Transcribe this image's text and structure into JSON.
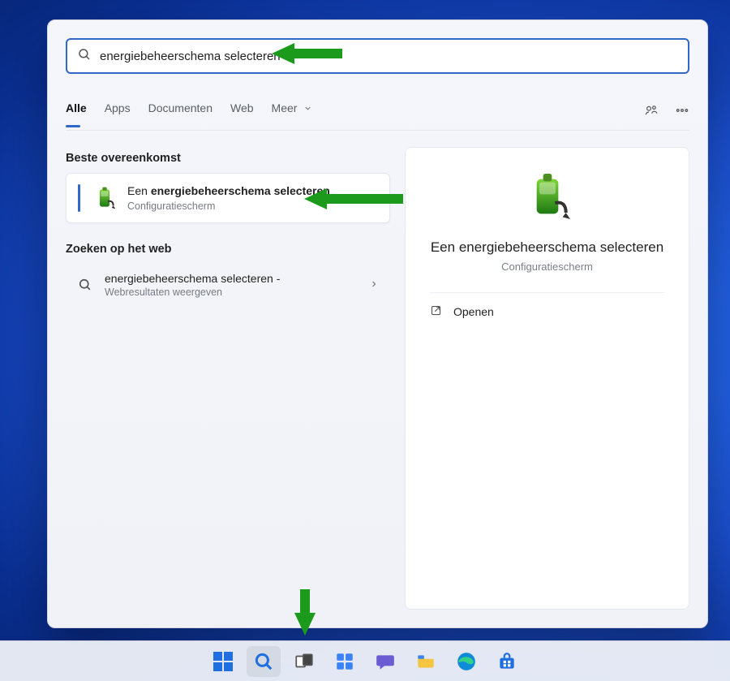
{
  "search": {
    "query": "energiebeheerschema selecteren"
  },
  "tabs": {
    "items": [
      "Alle",
      "Apps",
      "Documenten",
      "Web",
      "Meer"
    ],
    "active_index": 0
  },
  "sections": {
    "best_match_heading": "Beste overeenkomst",
    "web_heading": "Zoeken op het web"
  },
  "best_match": {
    "prefix": "Een ",
    "bold1": "energiebeheerschema",
    "bold2": "selecteren",
    "subtitle": "Configuratiescherm"
  },
  "web_results": [
    {
      "title": "energiebeheerschema selecteren -",
      "subtitle": "Webresultaten weergeven"
    }
  ],
  "detail": {
    "title": "Een energiebeheerschema selecteren",
    "subtitle": "Configuratiescherm",
    "actions": [
      {
        "label": "Openen"
      }
    ]
  },
  "taskbar": {
    "items": [
      "start",
      "search",
      "task-view",
      "widgets",
      "chat",
      "explorer",
      "edge",
      "store"
    ],
    "active": "search"
  },
  "icons": {
    "search": "search",
    "battery": "battery-power"
  }
}
